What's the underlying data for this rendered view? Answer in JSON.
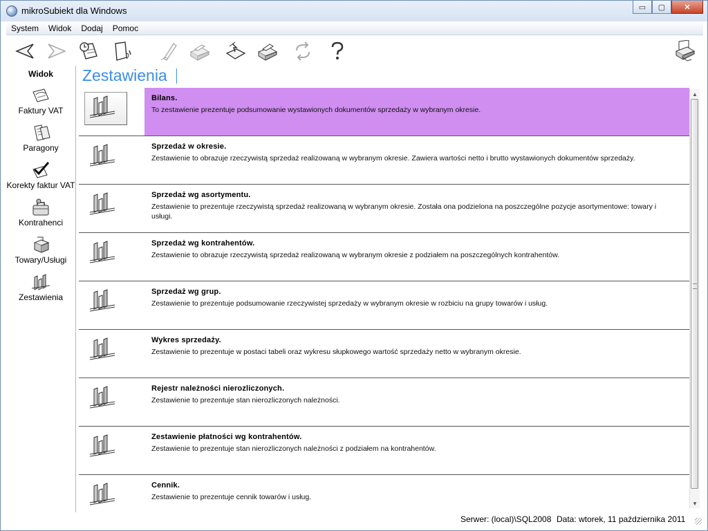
{
  "window": {
    "title": "mikroSubiekt dla Windows",
    "minimize": "▭",
    "maximize": "▢",
    "close": "✕"
  },
  "menu": [
    "System",
    "Widok",
    "Dodaj",
    "Pomoc"
  ],
  "toolbar": {
    "icons": [
      "back-arrow-icon",
      "forward-arrow-icon",
      "clock-document-icon",
      "page-curl-icon",
      "pen-icon",
      "printer-icon",
      "document-arrow-icon",
      "printer-document-icon",
      "recycle-icon",
      "help-icon",
      "printer-settings-icon"
    ]
  },
  "sidebar": {
    "header": "Widok",
    "items": [
      {
        "label": "Faktury VAT",
        "icon": "invoice-icon"
      },
      {
        "label": "Paragony",
        "icon": "receipt-icon"
      },
      {
        "label": "Korekty faktur VAT",
        "icon": "correction-icon"
      },
      {
        "label": "Kontrahenci",
        "icon": "contractors-icon"
      },
      {
        "label": "Towary/Usługi",
        "icon": "goods-icon"
      },
      {
        "label": "Zestawienia",
        "icon": "reports-icon"
      }
    ]
  },
  "main": {
    "heading": "Zestawienia",
    "reports": [
      {
        "title": "Bilans.",
        "desc": "To zestawienie prezentuje podsumowanie wystawionych dokumentów sprzedaży w wybranym okresie.",
        "selected": true
      },
      {
        "title": "Sprzedaż w okresie.",
        "desc": "Zestawienie to obrazuje rzeczywistą sprzedaż realizowaną w wybranym okresie. Zawiera wartości netto i brutto wystawionych dokumentów sprzedaży."
      },
      {
        "title": "Sprzedaż wg asortymentu.",
        "desc": "Zestawienie to prezentuje rzeczywistą sprzedaż realizowaną w wybranym okresie. Została ona podzielona na poszczególne pozycje asortymentowe: towary i usługi."
      },
      {
        "title": "Sprzedaż wg kontrahentów.",
        "desc": "Zestawienie to obrazuje rzeczywistą sprzedaż realizowaną w wybranym okresie z podziałem na poszczególnych kontrahentów."
      },
      {
        "title": "Sprzedaż wg grup.",
        "desc": "Zestawienie to prezentuje podsumowanie rzeczywistej sprzedaży w wybranym okresie w rozbiciu na grupy towarów i usług."
      },
      {
        "title": "Wykres sprzedaży.",
        "desc": "Zestawienie to prezentuje w postaci tabeli oraz wykresu słupkowego wartość sprzedaży netto w wybranym okresie."
      },
      {
        "title": "Rejestr należności nierozliczonych.",
        "desc": "Zestawienie to prezentuje stan nierozliczonych należności."
      },
      {
        "title": "Zestawienie płatności wg kontrahentów.",
        "desc": "Zestawienie to prezentuje stan nierozliczonych należności z podziałem na kontrahentów."
      },
      {
        "title": "Cennik.",
        "desc": "Zestawienie to prezentuje cennik towarów i usług."
      }
    ]
  },
  "status": {
    "server": "Serwer: (local)\\SQL2008",
    "date": "Data: wtorek, 11 października 2011"
  },
  "colors": {
    "selected_row": "#cf8ef0",
    "heading": "#3a8ee6"
  }
}
